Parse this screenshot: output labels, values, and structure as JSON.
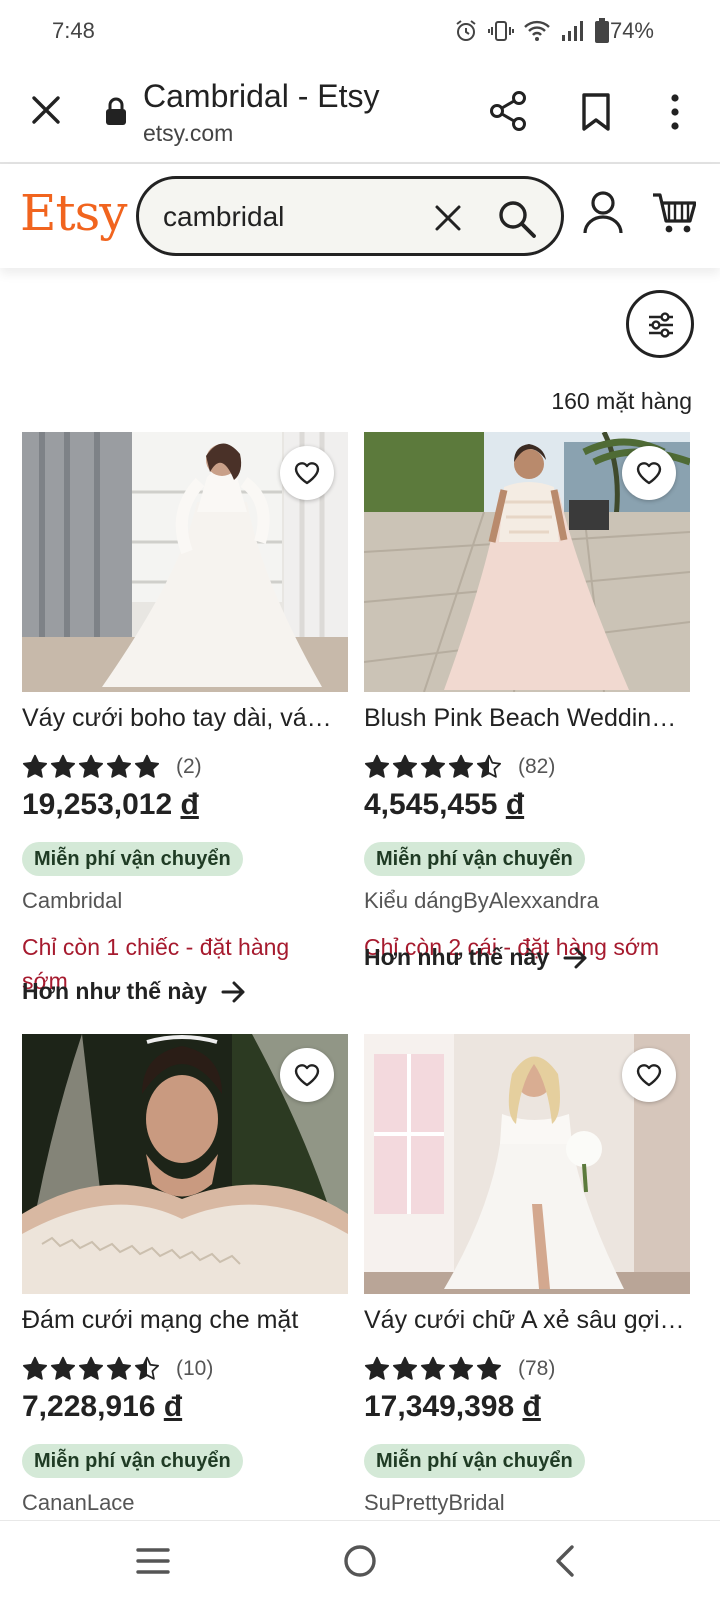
{
  "status": {
    "time": "7:48",
    "battery": "74%"
  },
  "browser": {
    "title": "Cambridal - Etsy",
    "url": "etsy.com"
  },
  "header": {
    "logo": "Etsy",
    "search_value": "cambridal"
  },
  "results": {
    "count_text": "160 mặt hàng"
  },
  "products": [
    {
      "title": "Váy cưới boho tay dài, vá…",
      "rating": 5,
      "reviews": "(2)",
      "price": "19,253,012",
      "currency": "đ",
      "shipping": "Miễn phí vận chuyển",
      "shop": "Cambridal",
      "stock": "Chỉ còn 1 chiếc - đặt hàng sớm",
      "more": "Hơn như thế này"
    },
    {
      "title": "Blush Pink Beach Weddin…",
      "rating": 4.5,
      "reviews": "(82)",
      "price": "4,545,455",
      "currency": "đ",
      "shipping": "Miễn phí vận chuyển",
      "shop": "Kiểu dángByAlexxandra",
      "stock": "Chỉ còn 2 cái - đặt hàng sớm",
      "more": "Hơn như thế này"
    },
    {
      "title": "Đám cưới mạng che mặt",
      "rating": 4.5,
      "reviews": "(10)",
      "price": "7,228,916",
      "currency": "đ",
      "shipping": "Miễn phí vận chuyển",
      "shop": "CananLace"
    },
    {
      "title": "Váy cưới chữ A xẻ sâu gợi…",
      "rating": 5,
      "reviews": "(78)",
      "price": "17,349,398",
      "currency": "đ",
      "shipping": "Miễn phí vận chuyển",
      "shop": "SuPrettyBridal"
    }
  ],
  "colors": {
    "brand": "#f1641e",
    "badge": "#d4e9d7",
    "warning": "#a61a2e"
  }
}
